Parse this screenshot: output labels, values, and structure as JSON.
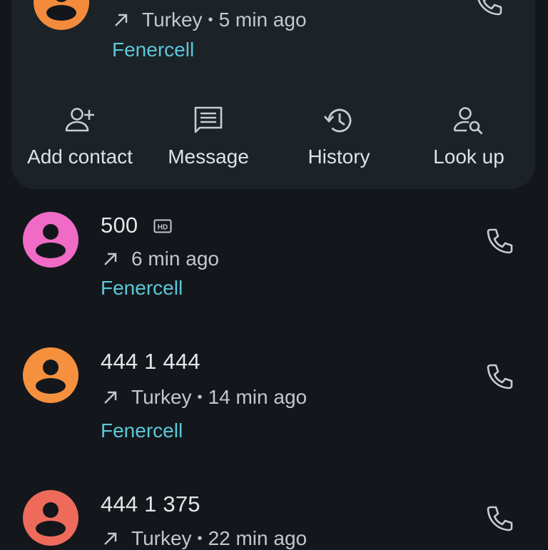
{
  "expanded_entry": {
    "location": "Turkey",
    "time": "5 min ago",
    "carrier": "Fenercell",
    "avatar_color": "#f28b3c"
  },
  "actions": [
    {
      "label": "Add contact",
      "icon": "add-person-icon"
    },
    {
      "label": "Message",
      "icon": "message-icon"
    },
    {
      "label": "History",
      "icon": "history-icon"
    },
    {
      "label": "Look up",
      "icon": "person-search-icon"
    }
  ],
  "calls": [
    {
      "number": "500",
      "hd": true,
      "location": "",
      "time": "6 min ago",
      "carrier": "Fenercell",
      "avatar_color": "#f06bc5"
    },
    {
      "number": "444 1 444",
      "hd": false,
      "location": "Turkey",
      "time": "14 min ago",
      "carrier": "Fenercell",
      "avatar_color": "#f5903f"
    },
    {
      "number": "444 1 375",
      "hd": false,
      "location": "Turkey",
      "time": "22 min ago",
      "carrier": "",
      "avatar_color": "#ee6b5c"
    }
  ],
  "colors": {
    "background": "#13171c",
    "card": "#1b2228",
    "carrier_text": "#5cc8d7"
  }
}
